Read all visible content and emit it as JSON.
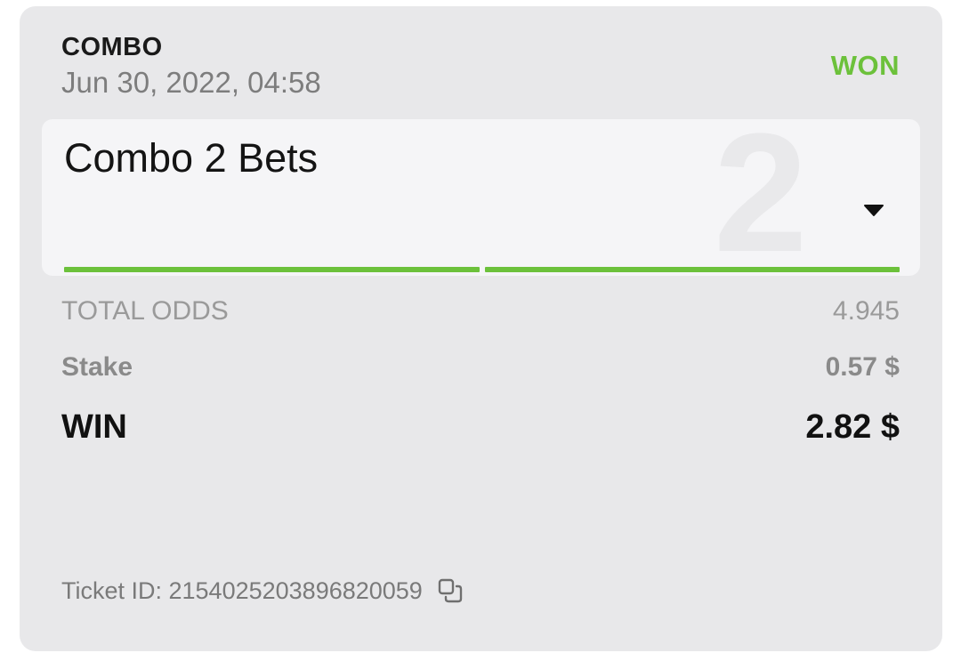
{
  "bet": {
    "type": "COMBO",
    "date": "Jun 30, 2022, 04:58",
    "status": "WON",
    "status_color": "#6cc13b"
  },
  "panel": {
    "title": "Combo 2 Bets",
    "watermark": "2",
    "dropdown_icon": "caret-down-icon",
    "legs_won": 2,
    "legs_total": 2
  },
  "summary": {
    "odds_label": "TOTAL ODDS",
    "odds_value": "4.945",
    "stake_label": "Stake",
    "stake_value": "0.57 $",
    "win_label": "WIN",
    "win_value": "2.82 $"
  },
  "ticket": {
    "label": "Ticket ID: 2154025203896820059",
    "copy_icon": "copy-icon"
  }
}
